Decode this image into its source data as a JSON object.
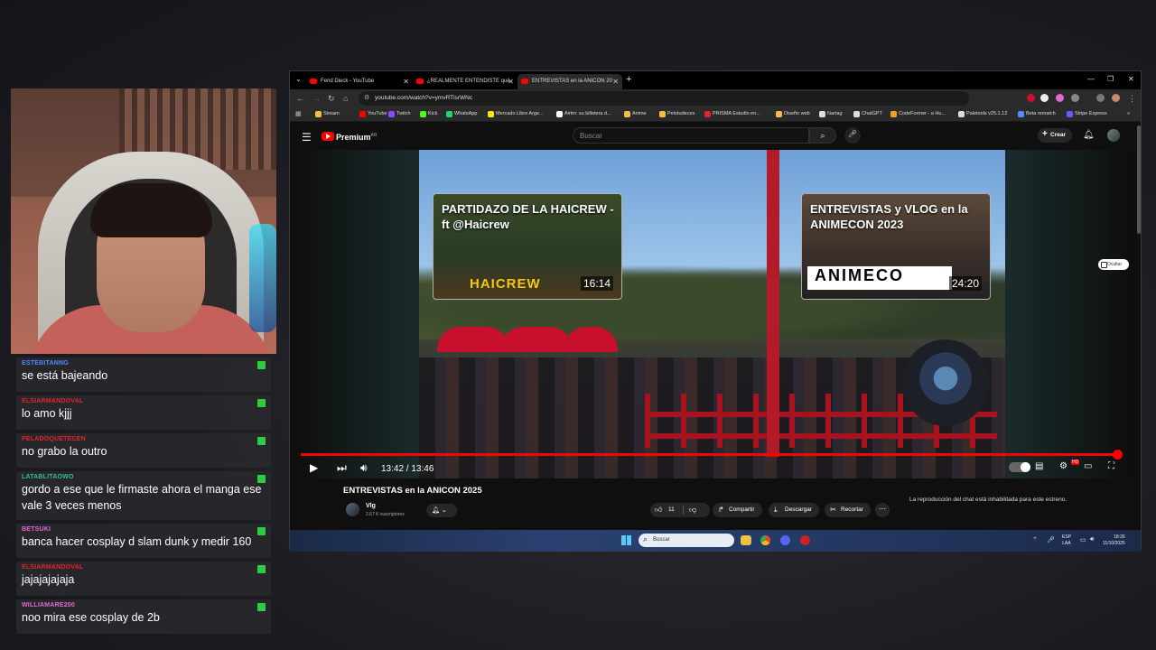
{
  "chat": {
    "messages": [
      {
        "user": "ESTEBITANNG",
        "color": "#4f8cff",
        "text": "se está bajeando"
      },
      {
        "user": "ELSIARMANDOVAL",
        "color": "#e0232e",
        "text": "lo amo kjjj"
      },
      {
        "user": "PELADOQUETECEN",
        "color": "#e0232e",
        "text": "no grabo la outro"
      },
      {
        "user": "LATABLITAOWO",
        "color": "#2fbf9f",
        "text": "gordo a ese que le firmaste ahora el manga ese vale 3 veces menos"
      },
      {
        "user": "BETSUKI",
        "color": "#e06bd0",
        "text": "banca hacer cosplay d slam dunk y medir 160"
      },
      {
        "user": "ELSIARMANDOVAL",
        "color": "#e0232e",
        "text": "jajajajajaja"
      },
      {
        "user": "WILLIAMARE200",
        "color": "#e06bd0",
        "text": "noo mira ese cosplay de 2b"
      }
    ]
  },
  "browser": {
    "tabs": [
      {
        "label": "Ferid Dieck - YouTube"
      },
      {
        "label": "¿REALMENTE ENTENDISTE qué"
      },
      {
        "label": "ENTREVISTAS en la ANICON 20"
      }
    ],
    "url": "youtube.com/watch?v=ymvRTlsrWNc",
    "bookmarks": [
      {
        "label": "Stream",
        "color": "#f0c040"
      },
      {
        "label": "YouTube",
        "color": "#ff0000"
      },
      {
        "label": "Twitch",
        "color": "#9146ff"
      },
      {
        "label": "Kick",
        "color": "#53fc18"
      },
      {
        "label": "WhatsApp",
        "color": "#25d366"
      },
      {
        "label": "Mercado Libre Arge...",
        "color": "#ffe600"
      },
      {
        "label": "Airtm: su billetera d...",
        "color": "#ffffff"
      },
      {
        "label": "Anime",
        "color": "#f0c040"
      },
      {
        "label": "Pelotudeces",
        "color": "#f0c040"
      },
      {
        "label": "PRISMA Estudio en...",
        "color": "#e0232e"
      },
      {
        "label": "Diseño web",
        "color": "#f0c040"
      },
      {
        "label": "Nartag",
        "color": "#dddddd"
      },
      {
        "label": "ChatGPT",
        "color": "#dddddd"
      },
      {
        "label": "CodeFormer - a Hu...",
        "color": "#f0a020"
      },
      {
        "label": "Paletools v25.1.12",
        "color": "#dddddd"
      },
      {
        "label": "Beta rematch",
        "color": "#4f8cff"
      },
      {
        "label": "Stripe Express",
        "color": "#635bff"
      }
    ]
  },
  "youtube": {
    "premium_label": "Premium",
    "region": "AR",
    "search_placeholder": "Buscar",
    "create_label": "Crear",
    "chat_pill": "Ocultar"
  },
  "player": {
    "time": "13:42 / 13:46",
    "progress_fraction": 0.9952,
    "endcards": [
      {
        "title": "PARTIDAZO DE LA HAICREW - ft @Haicrew",
        "brand": "HAICREW",
        "duration": "16:14"
      },
      {
        "title": "ENTREVISTAS y VLOG en la ANIMECON 2023",
        "brand": "ANIMECO",
        "duration": "24:20"
      }
    ]
  },
  "video": {
    "title": "ENTREVISTAS en la ANICON 2025",
    "channel": "Vlg",
    "subscribers": "2.67 K suscriptores",
    "likes": "11",
    "share_label": "Compartir",
    "download_label": "Descargar",
    "clip_label": "Recortar",
    "chat_disabled": "La reproducción del chat está inhabilitada para este estreno."
  },
  "taskbar": {
    "search_placeholder": "Buscar",
    "lang_top": "ESP",
    "lang_bottom": "LAA",
    "time": "18:26",
    "date": "11/10/2025"
  }
}
